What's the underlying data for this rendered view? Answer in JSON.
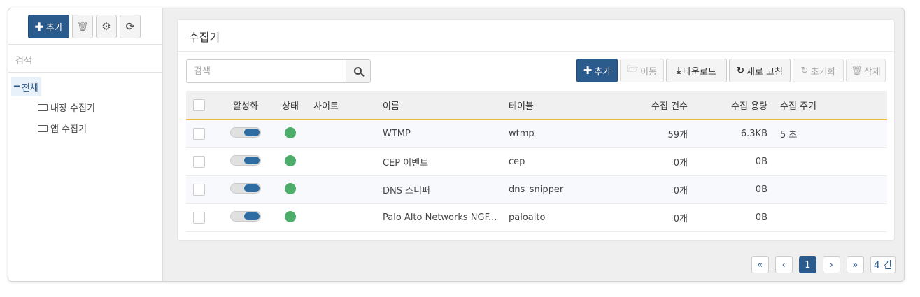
{
  "sidebar": {
    "add_label": "추가",
    "icons": {
      "add": "plus-icon",
      "delete": "trash-icon",
      "settings": "gear-icon",
      "refresh": "refresh-icon"
    },
    "search_placeholder": "검색",
    "tree": {
      "root": "전체",
      "children": [
        "내장 수집기",
        "앱 수집기"
      ]
    }
  },
  "panel": {
    "title": "수집기",
    "search_placeholder": "검색",
    "actions": {
      "add": "추가",
      "move": "이동",
      "download": "다운로드",
      "refresh": "새로 고침",
      "reset": "초기화",
      "delete": "삭제"
    },
    "columns": [
      "활성화",
      "상태",
      "사이트",
      "이름",
      "테이블",
      "수집 건수",
      "수집 용량",
      "수집 주기"
    ],
    "rows": [
      {
        "enabled": true,
        "status": "ok",
        "site": "",
        "name": "WTMP",
        "table": "wtmp",
        "count": "59개",
        "volume": "6.3KB",
        "period": "5 초"
      },
      {
        "enabled": true,
        "status": "ok",
        "site": "",
        "name": "CEP 이벤트",
        "table": "cep",
        "count": "0개",
        "volume": "0B",
        "period": ""
      },
      {
        "enabled": true,
        "status": "ok",
        "site": "",
        "name": "DNS 스니퍼",
        "table": "dns_snipper",
        "count": "0개",
        "volume": "0B",
        "period": ""
      },
      {
        "enabled": true,
        "status": "ok",
        "site": "",
        "name": "Palo Alto Networks NGF...",
        "table": "paloalto",
        "count": "0개",
        "volume": "0B",
        "period": ""
      }
    ]
  },
  "pager": {
    "first": "«",
    "prev": "‹",
    "current": "1",
    "next": "›",
    "last": "»",
    "total": "4 건"
  },
  "colors": {
    "accent": "#2b5a8c",
    "status_ok": "#4cae6a",
    "header_underline": "#f0b93a"
  }
}
